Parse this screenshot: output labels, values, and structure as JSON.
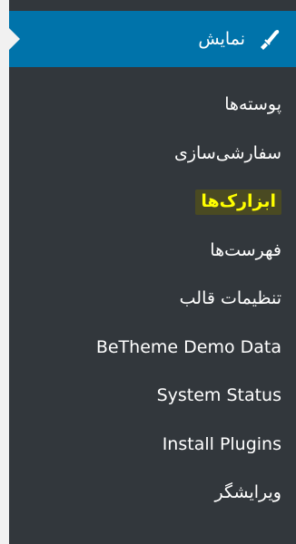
{
  "menu": {
    "header": {
      "label": "نمایش",
      "icon": "paintbrush-icon"
    },
    "items": [
      {
        "label": "پوسته‌ها"
      },
      {
        "label": "سفارشی‌سازی"
      },
      {
        "label": "ابزارک‌ها",
        "active": true
      },
      {
        "label": "فهرست‌ها"
      },
      {
        "label": "تنظیمات قالب"
      },
      {
        "label": "BeTheme Demo Data"
      },
      {
        "label": "System Status"
      },
      {
        "label": "Install Plugins"
      },
      {
        "label": "ویرایشگر"
      }
    ]
  },
  "colors": {
    "menu_background": "#32373c",
    "header_background": "#0073aa",
    "active_text": "#ffff00",
    "text": "#ffffff"
  }
}
